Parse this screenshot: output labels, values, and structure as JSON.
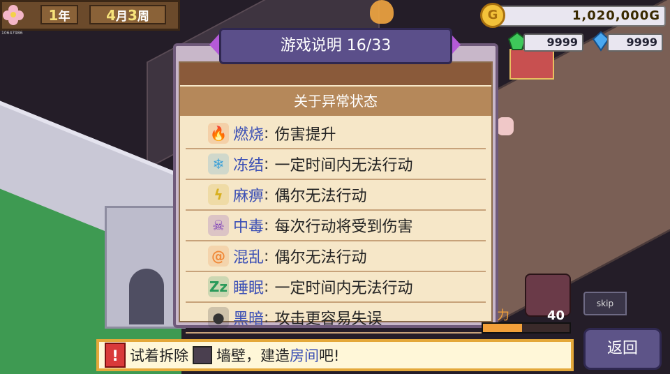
{
  "header": {
    "year_num": "1",
    "year_unit": "年",
    "month_num": "4",
    "month_unit": "月",
    "week_num": "3",
    "week_unit": "周",
    "tiny_id": "10647986"
  },
  "resources": {
    "gold": "1,020,000G",
    "green_gem": "9999",
    "blue_crystal": "9999"
  },
  "dialog": {
    "title": "游戏说明 16/33",
    "section_title": "关于异常状态",
    "statuses": [
      {
        "name": "燃烧",
        "desc": "伤害提升",
        "icon": "fire-icon",
        "color": "#f07a28",
        "glyph": "🔥"
      },
      {
        "name": "冻结",
        "desc": "一定时间内无法行动",
        "icon": "ice-icon",
        "color": "#3aa0d8",
        "glyph": "❄"
      },
      {
        "name": "麻痹",
        "desc": "偶尔无法行动",
        "icon": "lightning-icon",
        "color": "#d8b020",
        "glyph": "ϟ"
      },
      {
        "name": "中毒",
        "desc": "每次行动将受到伤害",
        "icon": "poison-skull-icon",
        "color": "#7a3ab8",
        "glyph": "☠"
      },
      {
        "name": "混乱",
        "desc": "偶尔无法行动",
        "icon": "confusion-swirl-icon",
        "color": "#f08a3a",
        "glyph": "@"
      },
      {
        "name": "睡眠",
        "desc": "一定时间内无法行动",
        "icon": "sleep-zz-icon",
        "color": "#2a9a5a",
        "glyph": "Zz"
      },
      {
        "name": "黑暗",
        "desc": "攻击更容易失误",
        "icon": "darkness-orb-icon",
        "color": "#333333",
        "glyph": "●"
      }
    ]
  },
  "hint": {
    "part1": "试着拆除",
    "part2": "墙壁，建造",
    "link": "房间",
    "part3": "吧!"
  },
  "controls": {
    "back_label": "返回",
    "skip_label": "skip",
    "boss_count": "40",
    "power_label": "力",
    "power_fraction": 0.45
  },
  "colors": {
    "accent_purple": "#5b4f8a",
    "arrow_purple": "#b45ad8",
    "status_name_blue": "#3b4fb5",
    "hint_border": "#e4a83a"
  }
}
